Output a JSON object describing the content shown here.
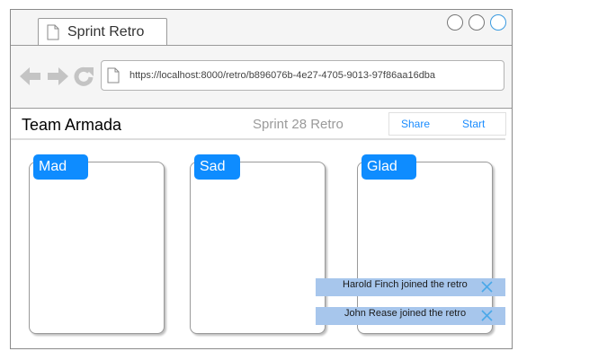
{
  "browser": {
    "tab_title": "Sprint Retro",
    "url": "https://localhost:8000/retro/b896076b-4e27-4705-9013-97f86aa16dba"
  },
  "header": {
    "team_name": "Team Armada",
    "sprint_name": "Sprint 28 Retro",
    "actions": [
      "Share",
      "Start"
    ]
  },
  "columns": [
    "Mad",
    "Sad",
    "Glad"
  ],
  "notifications": [
    "Harold Finch joined the retro",
    "John Rease joined the retro"
  ],
  "colors": {
    "accent": "#0e8cff",
    "link": "#1a8cff",
    "toast_bg": "#a7c6ec",
    "close_icon": "#4aa8e8"
  }
}
